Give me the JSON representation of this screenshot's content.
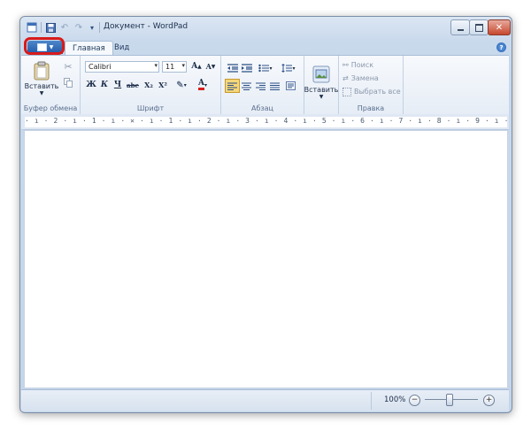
{
  "window": {
    "title": "Документ - WordPad"
  },
  "tabs": {
    "home": "Главная",
    "view": "Вид"
  },
  "clipboard": {
    "paste_label": "Вставить",
    "group_label": "Буфер обмена"
  },
  "font": {
    "family": "Calibri",
    "size": "11",
    "bold": "Ж",
    "italic": "К",
    "underline": "Ч",
    "strike": "abe",
    "subscript": "X₂",
    "superscript": "X²",
    "group_label": "Шрифт"
  },
  "paragraph": {
    "group_label": "Абзац"
  },
  "insert": {
    "label": "Вставить"
  },
  "editing": {
    "find": "Поиск",
    "replace": "Замена",
    "select_all": "Выбрать все",
    "group_label": "Правка"
  },
  "ruler": {
    "text": "· ı · 2 · ı · 1 · ı · ✕ · ı · 1 · ı · 2 · ı · 3 · ı · 4 · ı · 5 · ı · 6 · ı · 7 · ı · 8 · ı · 9 · ı ·10· ı ·11· ı ·12· ı ·13· ı ·14· ı ·15· ı ·16· ı ·17·"
  },
  "status": {
    "zoom": "100%",
    "zoom_level": 1.0
  },
  "colors": {
    "accent": "#1f5aa8",
    "highlight_ring": "#d81b1b",
    "ribbon": "#eef3f9"
  }
}
